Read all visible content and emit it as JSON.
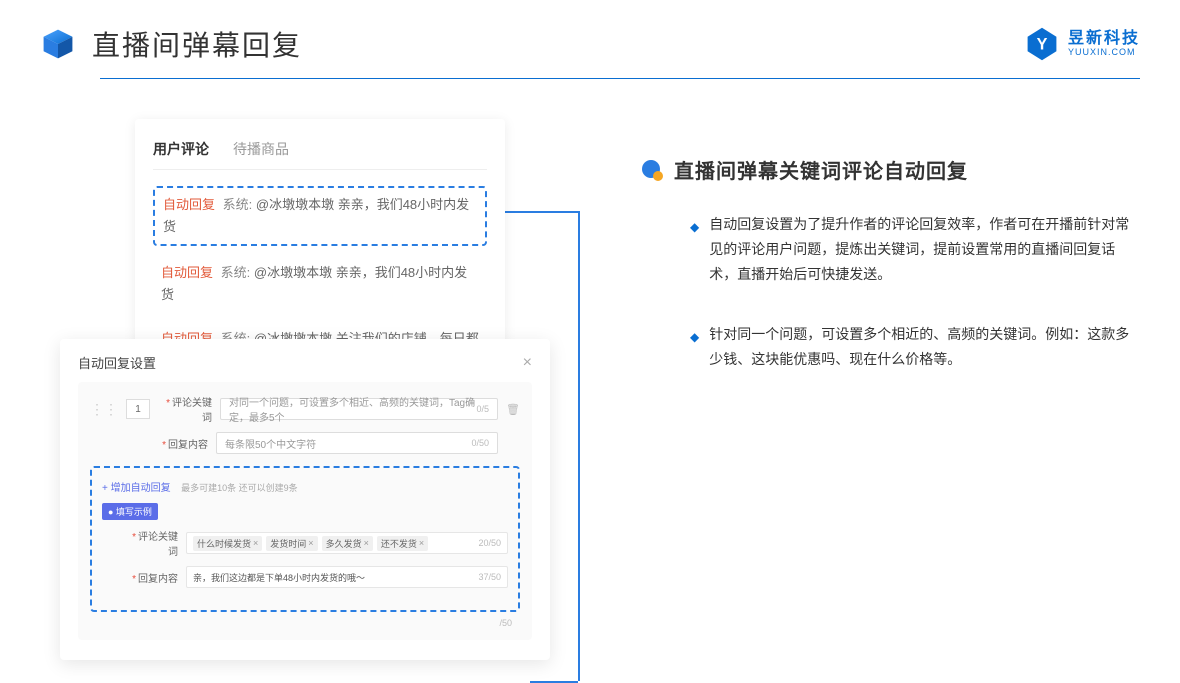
{
  "header": {
    "title": "直播间弹幕回复",
    "brand_cn": "昱新科技",
    "brand_en": "YUUXIN.COM"
  },
  "comments": {
    "tabs": [
      "用户评论",
      "待播商品"
    ],
    "active_tab": 0,
    "items": [
      {
        "badge": "自动回复",
        "sys": "系统:",
        "text": "@冰墩墩本墩 亲亲，我们48小时内发货",
        "highlighted": true
      },
      {
        "badge": "自动回复",
        "sys": "系统:",
        "text": "@冰墩墩本墩 亲亲，我们48小时内发货",
        "highlighted": false
      },
      {
        "badge": "自动回复",
        "sys": "系统:",
        "text": "@冰墩墩本墩 关注我们的店铺，每日都有热门推荐呦～",
        "highlighted": false
      }
    ]
  },
  "settings": {
    "title": "自动回复设置",
    "row_num": "1",
    "keyword_label": "评论关键词",
    "keyword_placeholder": "对同一个问题，可设置多个相近、高频的关键词，Tag确定，最多5个",
    "keyword_counter": "0/5",
    "content_label": "回复内容",
    "content_placeholder": "每条限50个中文字符",
    "content_counter": "0/50",
    "add_link": "+ 增加自动回复",
    "add_hint": "最多可建10条 还可以创建9条",
    "example_badge": "● 填写示例",
    "ex_keyword_label": "评论关键词",
    "ex_tags": [
      "什么时候发货",
      "发货时间",
      "多久发货",
      "还不发货"
    ],
    "ex_keyword_counter": "20/50",
    "ex_content_label": "回复内容",
    "ex_content_value": "亲，我们这边都是下单48小时内发货的哦～",
    "ex_content_counter": "37/50",
    "outer_counter": "/50"
  },
  "right": {
    "heading": "直播间弹幕关键词评论自动回复",
    "bullets": [
      "自动回复设置为了提升作者的评论回复效率，作者可在开播前针对常见的评论用户问题，提炼出关键词，提前设置常用的直播间回复话术，直播开始后可快捷发送。",
      "针对同一个问题，可设置多个相近的、高频的关键词。例如：这款多少钱、这块能优惠吗、现在什么价格等。"
    ]
  }
}
